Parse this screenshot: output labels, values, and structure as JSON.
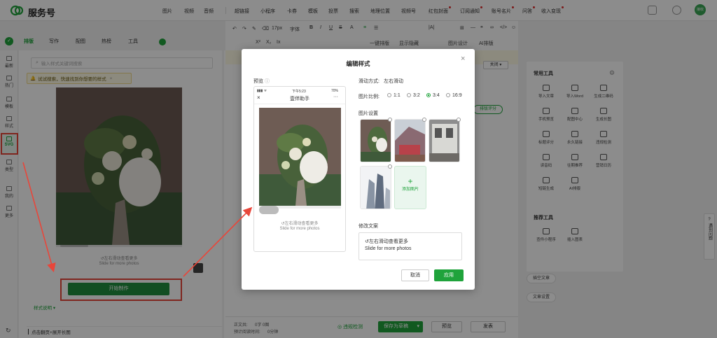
{
  "header": {
    "brand": "服务号",
    "nav": [
      "图片",
      "视频",
      "音频",
      "超链接",
      "小程序",
      "卡券",
      "模板",
      "投票",
      "搜索",
      "地理位置",
      "视频号",
      "红包封面",
      "订阅通知",
      "账号名片",
      "问答",
      "收入变现"
    ],
    "avatar_text": "接收"
  },
  "side_tabs": [
    "排版",
    "写作",
    "配图",
    "热榜",
    "工具"
  ],
  "toolbar": {
    "font_size": "17px",
    "font_family": "字体",
    "row2": [
      "X²",
      "X₂",
      "Ix",
      "一键排版",
      "显示隐藏",
      "图片设计",
      "AI排版"
    ]
  },
  "left_nav": [
    "最新",
    "热门",
    "模板",
    "样式",
    "SVG",
    "类型",
    "我的",
    "更多"
  ],
  "left_panel": {
    "search_placeholder": "输入样式关键词搜索",
    "search_tip": "试试搜索，快速找到你想要的样式",
    "caption_cn": "↺左右滑动查看更多",
    "caption_en": "Slide for more photos",
    "start_button": "开始制作",
    "style_help": "样式说明",
    "bottom_text": "点击翻页+展开长图"
  },
  "editor": {
    "top_right_select": "关闭",
    "score_tag": "排版评分"
  },
  "right_panel": {
    "common_title": "常用工具",
    "tools": [
      "导入文章",
      "导入Word",
      "生成二维码",
      "手机预览",
      "配图中心",
      "生成长图",
      "标题评分",
      "永久链接",
      "违规检测",
      "读音码",
      "往期推荐",
      "营销日历",
      "短链生成",
      "AI排版"
    ],
    "recommend_title": "推荐工具",
    "recommend_tools": [
      "查件小程序",
      "插入图表"
    ],
    "side_buttons": [
      "插空文章",
      "文章设置"
    ]
  },
  "help_box": "遇到问题",
  "bottom_bar": {
    "word_count": "正文共:",
    "count_value": "0字 0图",
    "read_time_label": "预计阅读时间:",
    "read_time_value": "0分钟",
    "check": "违规检测",
    "save": "保存为草稿",
    "preview": "预览",
    "publish": "发表"
  },
  "modal": {
    "title": "编辑样式",
    "preview_label": "预览",
    "phone_status_time": "下午5:23",
    "phone_battery": "70%",
    "phone_title": "壹伴助手",
    "phone_caption_cn": "↺左右滑动查看更多",
    "phone_caption_en": "Slide for more photos",
    "slide_mode_label": "滑动方式:",
    "slide_mode_value": "左右滑动",
    "ratio_label": "图片比例:",
    "ratios": [
      "1:1",
      "3:2",
      "3:4",
      "16:9"
    ],
    "ratio_selected": "3:4",
    "images_label": "图片设置",
    "add_image": "添加图片",
    "copy_label": "修改文案",
    "copy_line1": "↺左右滑动查看更多",
    "copy_line2": "Slide for more photos",
    "cancel": "取消",
    "apply": "应用"
  },
  "colors": {
    "accent": "#1fa33b",
    "highlight_red": "#e8463a"
  }
}
